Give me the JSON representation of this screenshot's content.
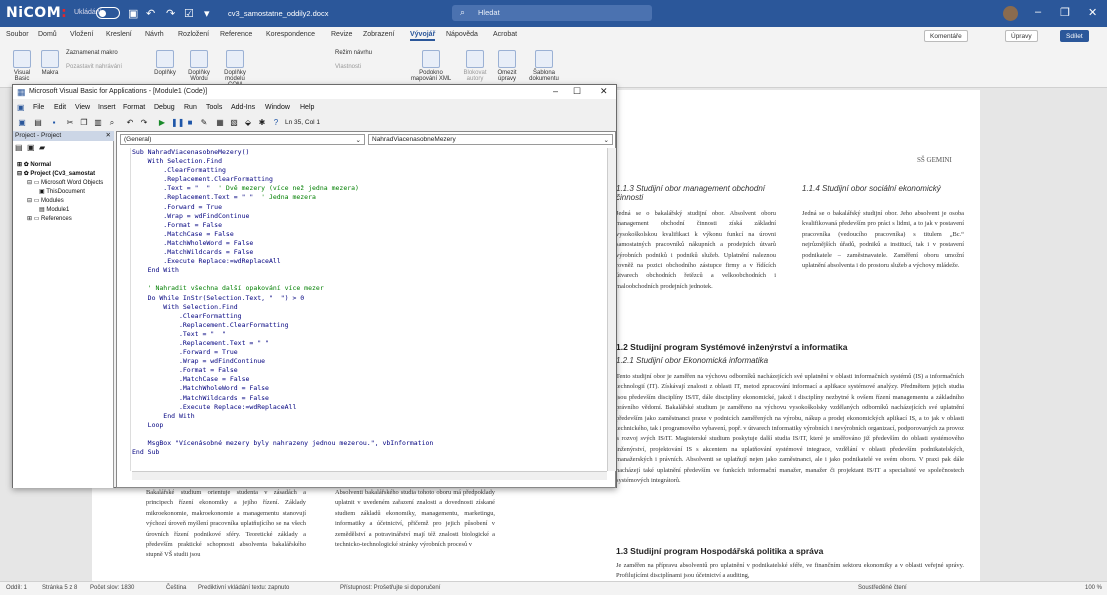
{
  "word": {
    "logo_a": "NiCOM",
    "logo_b": ":",
    "autosave": "Ukládání",
    "doc_title": "cv3_samostatne_oddily2.docx",
    "search_placeholder": "Hledat",
    "tabs": [
      "Soubor",
      "Domů",
      "Vložení",
      "Kreslení",
      "Návrh",
      "Rozložení",
      "Reference",
      "Korespondence",
      "Revize",
      "Zobrazení",
      "Vývojář",
      "Nápověda",
      "Acrobat"
    ],
    "active_tab": "Vývojář",
    "comments": "Komentáře",
    "editing": "Úpravy",
    "share": "Sdílet",
    "ribbon": [
      "Visual Basic",
      "Makra",
      "Zaznamenat makro",
      "Pozastavit nahrávání",
      "Doplňky",
      "Doplňky Wordu",
      "Doplňky modelu COM",
      "Režim návrhu",
      "Vlastnosti",
      "Podokno mapování XML",
      "Blokovat autory",
      "Omezit úpravy",
      "Šablona dokumentu"
    ],
    "status": {
      "section": "Oddíl: 1",
      "page": "Stránka 5 z 8",
      "words": "Počet slov: 1830",
      "lang": "Čeština",
      "predict": "Prediktivní vkládání textu: zapnuto",
      "access": "Přístupnost: Prošetřujte si doporučení",
      "focus": "Soustředěné čtení",
      "zoom": "100 %"
    }
  },
  "vbe": {
    "title": "Microsoft Visual Basic for Applications - [Module1 (Code)]",
    "menus": [
      "File",
      "Edit",
      "View",
      "Insert",
      "Format",
      "Debug",
      "Run",
      "Tools",
      "Add-Ins",
      "Window",
      "Help"
    ],
    "position": "Ln 35, Col 1",
    "project_header": "Project - Project",
    "tree": [
      "Normal",
      "Project (Cv3_samostat",
      "Microsoft Word Objects",
      "ThisDocument",
      "Modules",
      "Module1",
      "References"
    ],
    "combo_left": "(General)",
    "combo_right": "NahradViacenasobneMezery",
    "code": [
      [
        "kw",
        "Sub NahradViacenasobneMezery()"
      ],
      [
        "kw",
        "    With Selection.Find"
      ],
      [
        "kw",
        "        .ClearFormatting"
      ],
      [
        "kw",
        "        .Replacement.ClearFormatting"
      ],
      [
        "mix",
        "        .Text = \"  \"  ' Dvě mezery (více než jedna mezera)"
      ],
      [
        "mix",
        "        .Replacement.Text = \" \"  ' Jedna mezera"
      ],
      [
        "kw",
        "        .Forward = True"
      ],
      [
        "kw",
        "        .Wrap = wdFindContinue"
      ],
      [
        "kw",
        "        .Format = False"
      ],
      [
        "kw",
        "        .MatchCase = False"
      ],
      [
        "kw",
        "        .MatchWholeWord = False"
      ],
      [
        "kw",
        "        .MatchWildcards = False"
      ],
      [
        "kw",
        "        .Execute Replace:=wdReplaceAll"
      ],
      [
        "kw",
        "    End With"
      ],
      [
        "kw",
        ""
      ],
      [
        "cm",
        "    ' Nahradit všechna další opakování více mezer"
      ],
      [
        "kw",
        "    Do While InStr(Selection.Text, \"  \") > 0"
      ],
      [
        "kw",
        "        With Selection.Find"
      ],
      [
        "kw",
        "            .ClearFormatting"
      ],
      [
        "kw",
        "            .Replacement.ClearFormatting"
      ],
      [
        "kw",
        "            .Text = \"  \""
      ],
      [
        "kw",
        "            .Replacement.Text = \" \""
      ],
      [
        "kw",
        "            .Forward = True"
      ],
      [
        "kw",
        "            .Wrap = wdFindContinue"
      ],
      [
        "kw",
        "            .Format = False"
      ],
      [
        "kw",
        "            .MatchCase = False"
      ],
      [
        "kw",
        "            .MatchWholeWord = False"
      ],
      [
        "kw",
        "            .MatchWildcards = False"
      ],
      [
        "kw",
        "            .Execute Replace:=wdReplaceAll"
      ],
      [
        "kw",
        "        End With"
      ],
      [
        "kw",
        "    Loop"
      ],
      [
        "kw",
        ""
      ],
      [
        "kw",
        "    MsgBox \"Vícenásobné mezery byly nahrazeny jednou mezerou.\", vbInformation"
      ],
      [
        "kw",
        "End Sub"
      ]
    ]
  },
  "doc": {
    "header_right": "SŠ GEMINI",
    "h113": "1.1.3  Studijní obor management obchodní činnosti",
    "h114": "1.1.4  Studijní obor sociální ekonomický",
    "p113": "Jedná se o bakalářský studijní obor. Absolvent oboru management obchodní činnosti získá základní vysokoškolskou kvalifikaci k výkonu funkcí na úrovni samostatných pracovníků nákupních a prodejních útvarů výrobních podniků i podniků služeb. Uplatnění naleznou rovněž na pozici obchodního zástupce firmy a v řídících útvarech obchodních řetězců a velkoobchodních i maloobchodních prodejních jednotek.",
    "p114": "Jedná se o bakalářský studijní obor. Jeho absolvent je osoba kvalifikovaná především pro práci s lidmi, a to jak v postavení pracovníka (vedoucího pracovníka) s titulem „Bc.“ nejrůznějších úřadů, podniků a institucí, tak i v postavení podnikatele – zaměstnavatele. Zaměření oboru umožní uplatnění absolventa i do prostoru služeb a výchovy mládeže.",
    "h12": "1.2   Studijní program Systémové inženýrství a informatika",
    "h121": "1.2.1  Studijní obor Ekonomická informatika",
    "p121": "Tento studijní obor je zaměřen na výchovu odborníků nacházejících své uplatnění v oblasti informačních systémů (IS) a informačních technologií (IT). Získávají znalosti z oblasti IT, metod zpracování informací a aplikace systémové analýzy. Předmětem jejich studia jsou především disciplíny IS/IT, dále disciplíny ekonomické, jakož i disciplíny nezbytné k ovšem řízení managementu a základního právního vědomí. Bakalářské studium je zaměřeno na výchovu vysokoškolsky vzdělaných odborníků nacházejících své uplatnění především jako zaměstnanci praxe v podnicích zaměřených na výrobu, nákup a prodej ekonomických aplikací IS, a to jak v oblasti technického, tak i programového vybavení, popř. v útvarech informatiky výrobních i nevýrobních organizací, podporovaných za provoz a rozvoj svých IS/IT. Magisterské studium poskytuje další studia IS/IT, které je směřováno již především do oblasti systémového inženýrství, projektování IS s akcentem na uplatňování systémové integrace, vzdělání v oblasti především podnikatelských, manažerských i právních. Absolventi se uplatňují nejen jako zaměstnanci, ale i jako podnikatelé ve svém oboru. V praxi pak dále nacházejí také uplatnění především ve funkcích informační manažer, manažer či projektant IS/IT a specialisté ve společnostech systémových integrátorů.",
    "h13": "1.3   Studijní program Hospodářská politika a správa",
    "p13": "Je zaměřen na přípravu absolventů pro uplatnění v podnikatelské sféře, ve finančním sektoru ekonomiky a v oblasti veřejné správy. Profilujícími disciplínami jsou účetnictví a auditing,",
    "left_col1": "Bakalářské studium orientuje studenta v zásadách a principech řízení ekonomiky a jejího řízení. Základy mikroekonomie, makroekonomie a managementu stanovují výchozí úroveň myšlení pracovníka uplatňujícího se na všech úrovních řízení podnikové sféry. Teoretické základy a především praktické schopnosti absolventa bakalářského stupně VŠ studii jsou",
    "left_col2": "Absolventi bakalářského studia tohoto oboru má předpoklady uplatnit v uvedeném zařazení znalosti a dovednosti získané studiem základů ekonomiky, managementu, marketingu, informatiky a účetnictví, přičemž pro jejich působení v zemědělství a potravinářství mají též znalosti biologické a technicko-technologické stránky výrobních procesů v",
    "sub": "Sub"
  }
}
